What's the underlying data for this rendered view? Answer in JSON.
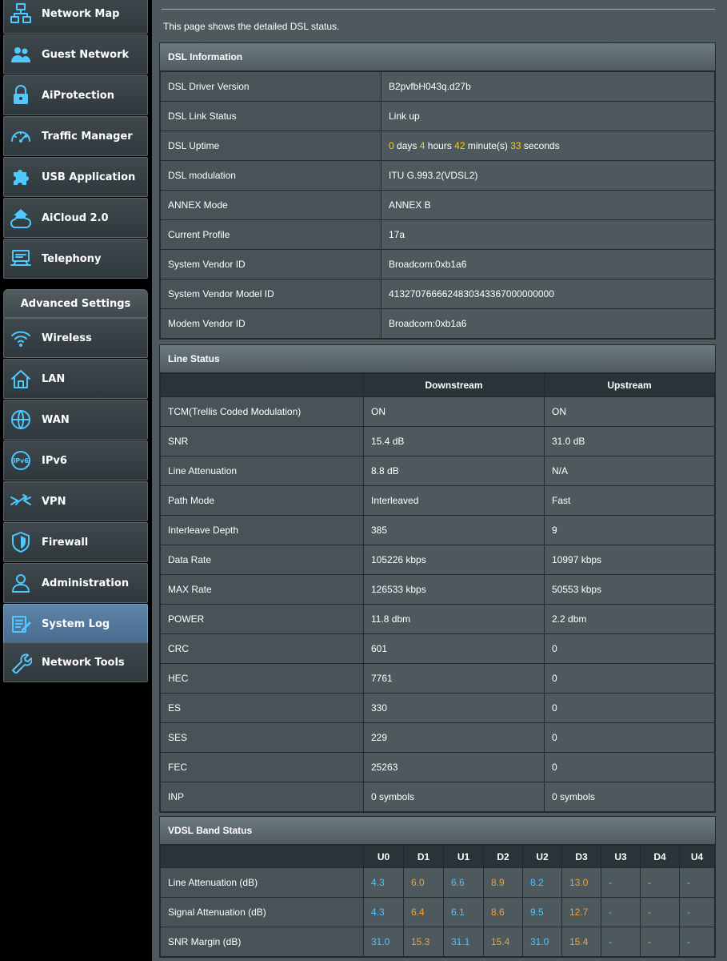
{
  "sidebar": {
    "items": [
      {
        "label": "Network Map",
        "icon": "network-map-icon"
      },
      {
        "label": "Guest Network",
        "icon": "guest-network-icon"
      },
      {
        "label": "AiProtection",
        "icon": "lock-icon"
      },
      {
        "label": "Traffic Manager",
        "icon": "gauge-icon"
      },
      {
        "label": "USB Application",
        "icon": "puzzle-icon"
      },
      {
        "label": "AiCloud 2.0",
        "icon": "cloud-icon"
      },
      {
        "label": "Telephony",
        "icon": "telephony-icon"
      }
    ],
    "advanced_title": "Advanced Settings",
    "advanced_items": [
      {
        "label": "Wireless",
        "icon": "wifi-icon"
      },
      {
        "label": "LAN",
        "icon": "home-icon"
      },
      {
        "label": "WAN",
        "icon": "globe-icon"
      },
      {
        "label": "IPv6",
        "icon": "ipv6-icon"
      },
      {
        "label": "VPN",
        "icon": "vpn-icon"
      },
      {
        "label": "Firewall",
        "icon": "shield-icon"
      },
      {
        "label": "Administration",
        "icon": "user-icon"
      },
      {
        "label": "System Log",
        "icon": "log-icon",
        "active": true
      },
      {
        "label": "Network Tools",
        "icon": "tools-icon"
      }
    ]
  },
  "intro": "This page shows the detailed DSL status.",
  "dsl_info": {
    "title": "DSL Information",
    "rows": [
      {
        "label": "DSL Driver Version",
        "value": "B2pvfbH043q.d27b"
      },
      {
        "label": "DSL Link Status",
        "value": "Link up"
      },
      {
        "label": "DSL Uptime",
        "value": ""
      },
      {
        "label": "DSL modulation",
        "value": "ITU G.993.2(VDSL2)"
      },
      {
        "label": "ANNEX Mode",
        "value": "ANNEX B"
      },
      {
        "label": "Current Profile",
        "value": "17a"
      },
      {
        "label": "System Vendor ID",
        "value": "Broadcom:0xb1a6"
      },
      {
        "label": "System Vendor Model ID",
        "value": "4132707666624830343367000000000"
      },
      {
        "label": "Modem Vendor ID",
        "value": "Broadcom:0xb1a6"
      }
    ],
    "uptime": {
      "days": "0",
      "days_unit": "days",
      "hours": "4",
      "hours_unit": "hours",
      "minutes": "42",
      "minutes_unit": "minute(s)",
      "seconds": "33",
      "seconds_unit": "seconds"
    }
  },
  "line_status": {
    "title": "Line Status",
    "col_downstream": "Downstream",
    "col_upstream": "Upstream",
    "rows": [
      {
        "label": "TCM(Trellis Coded Modulation)",
        "down": "ON",
        "up": "ON"
      },
      {
        "label": "SNR",
        "down": "15.4 dB",
        "up": "31.0 dB"
      },
      {
        "label": "Line Attenuation",
        "down": "8.8 dB",
        "up": "N/A"
      },
      {
        "label": "Path Mode",
        "down": "Interleaved",
        "up": "Fast"
      },
      {
        "label": "Interleave Depth",
        "down": "385",
        "up": "9"
      },
      {
        "label": "Data Rate",
        "down": "105226 kbps",
        "up": "10997 kbps"
      },
      {
        "label": "MAX Rate",
        "down": "126533 kbps",
        "up": "50553 kbps"
      },
      {
        "label": "POWER",
        "down": "11.8 dbm",
        "up": "2.2 dbm"
      },
      {
        "label": "CRC",
        "down": "601",
        "up": "0"
      },
      {
        "label": "HEC",
        "down": "7761",
        "up": "0"
      },
      {
        "label": "ES",
        "down": "330",
        "up": "0"
      },
      {
        "label": "SES",
        "down": "229",
        "up": "0"
      },
      {
        "label": "FEC",
        "down": "25263",
        "up": "0"
      },
      {
        "label": "INP",
        "down": "0 symbols",
        "up": "0 symbols"
      }
    ]
  },
  "vdsl_band": {
    "title": "VDSL Band Status",
    "bands": [
      "U0",
      "D1",
      "U1",
      "D2",
      "U2",
      "D3",
      "U3",
      "D4",
      "U4"
    ],
    "rows": [
      {
        "label": "Line Attenuation (dB)",
        "values": [
          "4.3",
          "6.0",
          "6.6",
          "8.9",
          "8.2",
          "13.0",
          "-",
          "-",
          "-"
        ]
      },
      {
        "label": "Signal Attenuation (dB)",
        "values": [
          "4.3",
          "6.4",
          "6.1",
          "8.6",
          "9.5",
          "12.7",
          "-",
          "-",
          "-"
        ]
      },
      {
        "label": "SNR Margin (dB)",
        "values": [
          "31.0",
          "15.3",
          "31.1",
          "15.4",
          "31.0",
          "15.4",
          "-",
          "-",
          "-"
        ]
      }
    ]
  },
  "colors": {
    "highlight_yellow": "#ffcc00",
    "upstream_blue": "#4ec3ff",
    "downstream_orange": "#ff9d28",
    "active_nav": "#5f84a8"
  }
}
